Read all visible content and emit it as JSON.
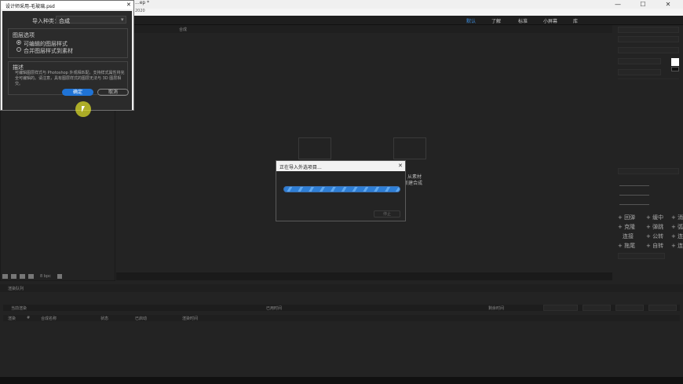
{
  "titlebar": {
    "doc_title": "...ep *",
    "min": "—",
    "max": "☐",
    "close": "✕"
  },
  "menubar": {
    "subtitle": "2020"
  },
  "workspaces": [
    {
      "label": "默认",
      "active": true
    },
    {
      "label": "了解",
      "active": false
    },
    {
      "label": "标准",
      "active": false
    },
    {
      "label": "小屏幕",
      "active": false
    },
    {
      "label": "库",
      "active": false
    }
  ],
  "import_dialog": {
    "title": "设计师采用-毛玻璃.psd",
    "import_type_label": "导入种类：",
    "import_type_value": "合成",
    "layer_options_title": "图层选项",
    "option1": "可编辑的图层样式",
    "option2": "合并图层样式到素材",
    "desc_title": "描述",
    "desc_text": "可编辑图层样式与 Photoshop 外观相匹配。支持样式属性将完全可编辑的。请注意，具有图层样式的图层无法与 3D 图层相交。",
    "ok": "确定",
    "cancel": "取消"
  },
  "progress_dialog": {
    "title": "正在导入外选项目...",
    "stop": "停止",
    "progress": 1.0
  },
  "comp": {
    "tab_label": "合成",
    "new_from_footage": "从素材",
    "new_comp": "新建合成"
  },
  "left_footer": {
    "bpc": "8 bpc"
  },
  "timeline": {
    "render_queue": "渲染队列",
    "current_render": "当前渲染",
    "elapsed": "已用时间",
    "remaining": "剩余时间",
    "cols": [
      "渲染",
      "#",
      "合成名称",
      "状态",
      "已启动",
      "渲染时间"
    ]
  },
  "right_panel": {
    "tools": [
      [
        "+ 回弹",
        "+ 缓中",
        "+ 消"
      ],
      [
        "+ 克隆",
        "+ 弹跳",
        "+ 弧"
      ],
      [
        "连接",
        "+ 公转",
        "+ 连"
      ],
      [
        "+ 拖尾",
        "+ 自转",
        "+ 连"
      ]
    ]
  },
  "colors": {
    "accent": "#2f7fd6",
    "bg": "#232323"
  }
}
